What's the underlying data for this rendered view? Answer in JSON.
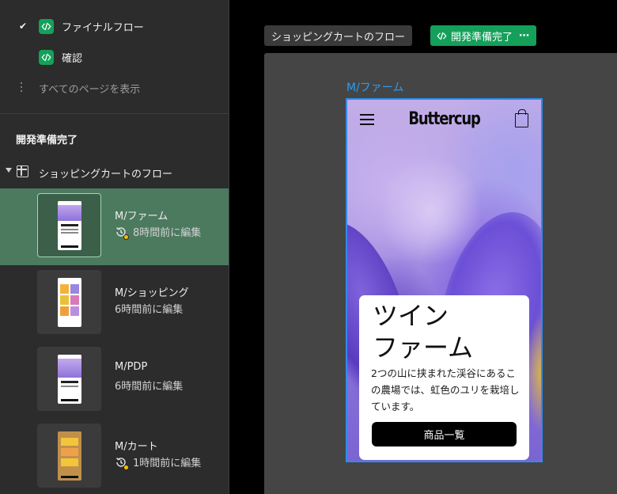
{
  "sidebar": {
    "pages": [
      {
        "label": "ファイナルフロー",
        "checked": true,
        "icon": "dev-mode-icon"
      },
      {
        "label": "確認",
        "checked": false,
        "icon": "dev-mode-icon"
      }
    ],
    "show_all_label": "すべてのページを表示",
    "section_title": "開発準備完了",
    "flow_label": "ショッピングカートのフロー",
    "frames": [
      {
        "name": "M/ファーム",
        "meta": "8時間前に編集",
        "selected": true,
        "history_badge": true
      },
      {
        "name": "M/ショッピング",
        "meta": "6時間前に編集",
        "selected": false,
        "history_badge": false
      },
      {
        "name": "M/PDP",
        "meta": "6時間前に編集",
        "selected": false,
        "history_badge": false
      },
      {
        "name": "M/カート",
        "meta": "1時間前に編集",
        "selected": false,
        "history_badge": true
      }
    ]
  },
  "canvas": {
    "flow_tag": "ショッピングカートのフロー",
    "status_tag": "開発準備完了",
    "status_more": "⋯",
    "frame_label": "M/ファーム",
    "phone": {
      "brand": "Buttercup",
      "card_title_line1": "ツイン",
      "card_title_line2": "ファーム",
      "card_body": "2つの山に挟まれた渓谷にあるこの農場では、虹色のユリを栽培しています。",
      "button_label": "商品一覧"
    }
  },
  "colors": {
    "accent_green": "#14a05a",
    "selection_blue": "#2d8cf0",
    "selected_row": "#4c7a5f",
    "badge_yellow": "#f5c000"
  }
}
